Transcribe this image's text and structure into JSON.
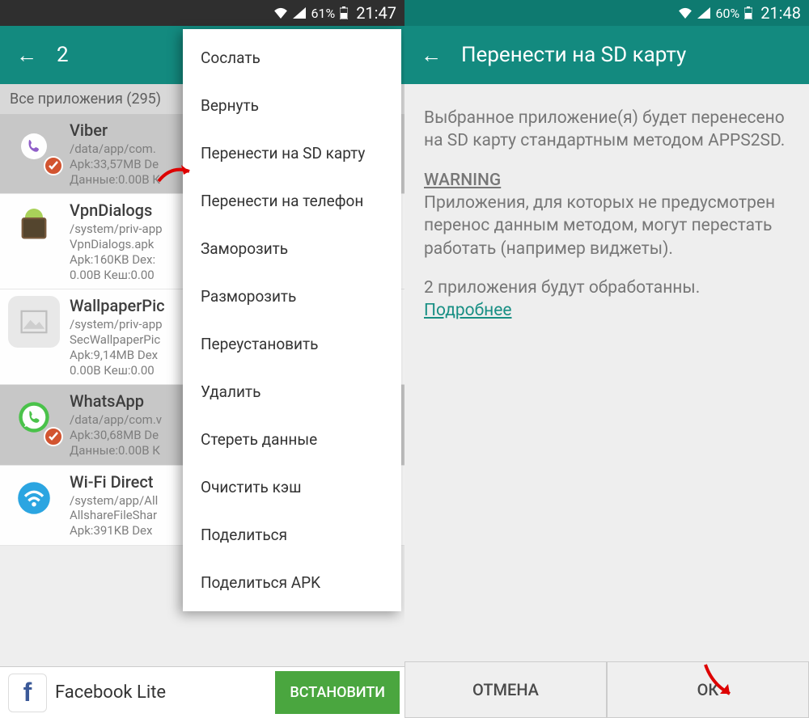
{
  "left": {
    "status": {
      "battery": "61%",
      "time": "21:47"
    },
    "appbar": {
      "title": "2"
    },
    "section": "Все приложения (295)",
    "apps": [
      {
        "name": "Viber",
        "path": "/data/app/com.",
        "line2": "Apk:33,57MB  De",
        "line3": "Данные:0.00B  К",
        "sel": true,
        "iconBg": "#8a55c6"
      },
      {
        "name": "VpnDialogs",
        "path": "/system/priv-app",
        "line2": "VpnDialogs.apk",
        "line3": "Apk:160KB  Dex:",
        "line4": "0.00B Кеш:0.00",
        "sel": false,
        "iconBg": "#a5cf4f"
      },
      {
        "name": "WallpaperPic",
        "path": "/system/priv-app",
        "line2": "SecWallpaperPic",
        "line3": "Apk:9,14MB  Dex",
        "line4": "0.00B Кеш:0.00",
        "sel": false,
        "iconBg": "#e8e8e8"
      },
      {
        "name": "WhatsApp",
        "path": "/data/app/com.v",
        "line2": "Apk:30,68MB  De",
        "line3": "Данные:0.00B  К",
        "sel": true,
        "iconBg": "#3fbf3f"
      },
      {
        "name": "Wi-Fi Direct",
        "path": "/system/app/All",
        "line2": "AllshareFileShar",
        "line3": "Apk:391KB  Dex",
        "sel": false,
        "iconBg": "#1fa0e0"
      }
    ],
    "menu": [
      "Сослать",
      "Вернуть",
      "Перенести на SD карту",
      "Перенести на телефон",
      "Заморозить",
      "Разморозить",
      "Переустановить",
      "Удалить",
      "Стереть данные",
      "Очистить кэш",
      "Поделиться",
      "Поделиться APK"
    ],
    "ad": {
      "text": "Facebook Lite",
      "button": "ВСТАНОВИТИ"
    }
  },
  "right": {
    "status": {
      "battery": "60%",
      "time": "21:48"
    },
    "appbar": {
      "title": "Перенести на SD карту"
    },
    "body": {
      "p1": "Выбранное приложение(я) будет перенесено на SD карту стандартным методом APPS2SD.",
      "warn": "WARNING",
      "p2": "Приложения, для которых не предусмотрен перенос данным методом, могут перестать работать (например виджеты).",
      "p3": "2 приложения будут обработанны.",
      "link": "Подробнее"
    },
    "buttons": {
      "cancel": "ОТМЕНА",
      "ok": "ОК"
    }
  }
}
